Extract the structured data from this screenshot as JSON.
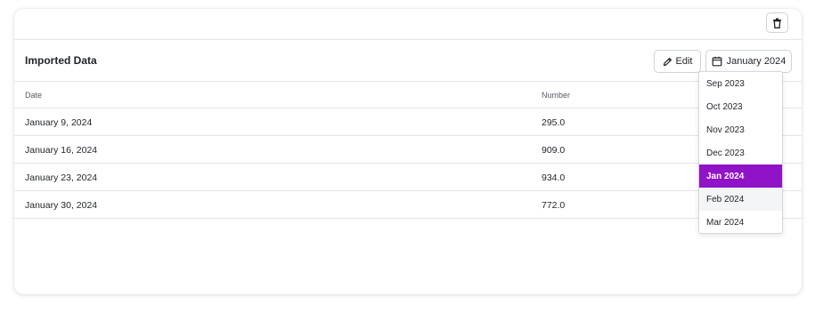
{
  "header": {
    "title": "Imported Data",
    "edit_label": "Edit",
    "month_label": "January 2024"
  },
  "icons": {
    "trash": "trash-icon",
    "pencil": "pencil-icon",
    "calendar": "calendar-icon"
  },
  "table": {
    "columns": [
      "Date",
      "Number"
    ],
    "rows": [
      {
        "date": "January 9, 2024",
        "number": "295.0"
      },
      {
        "date": "January 16, 2024",
        "number": "909.0"
      },
      {
        "date": "January 23, 2024",
        "number": "934.0"
      },
      {
        "date": "January 30, 2024",
        "number": "772.0"
      }
    ]
  },
  "month_dropdown": {
    "options": [
      "Sep 2023",
      "Oct 2023",
      "Nov 2023",
      "Dec 2023",
      "Jan 2024",
      "Feb 2024",
      "Mar 2024"
    ],
    "selected": "Jan 2024",
    "hovered": "Feb 2024"
  },
  "colors": {
    "accent": "#9013c7",
    "border": "#e3e5e8"
  }
}
